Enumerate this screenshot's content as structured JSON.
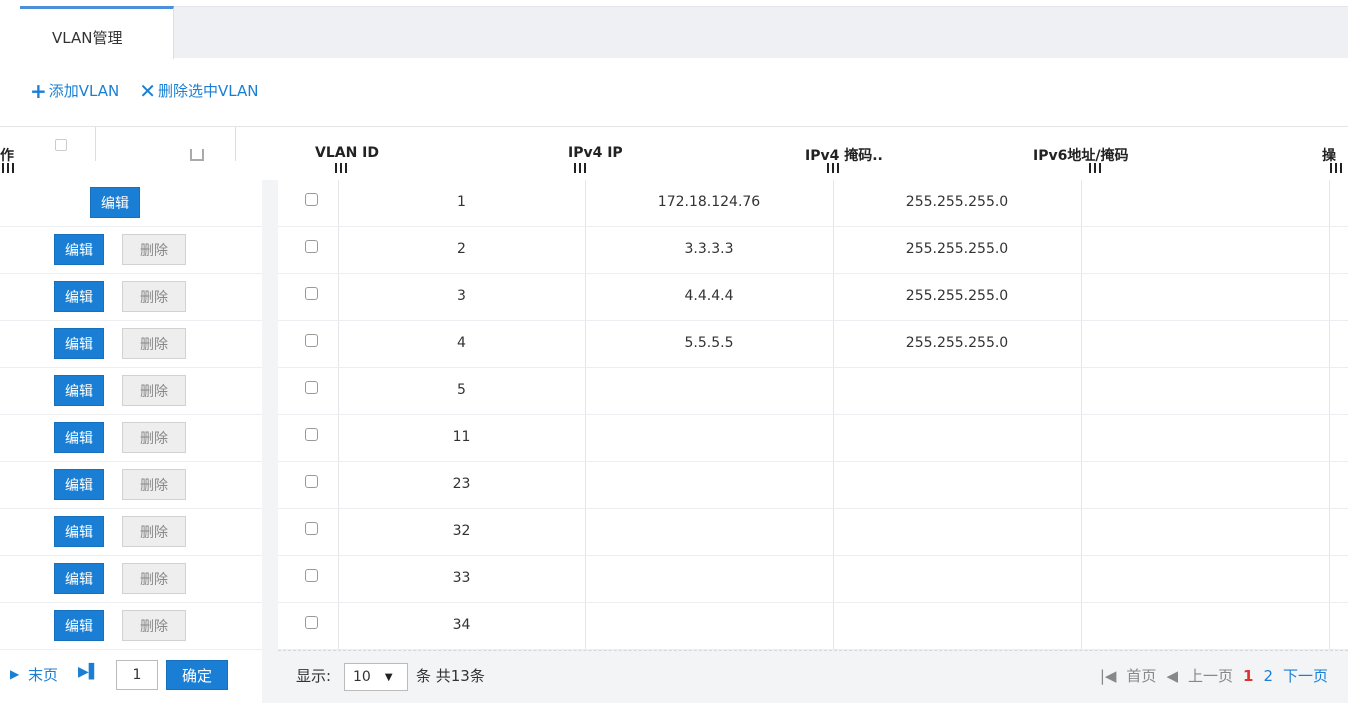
{
  "tabs": [
    {
      "label": "VLAN管理"
    }
  ],
  "toolbar": {
    "add_label": "添加VLAN",
    "delete_selected_label": "删除选中VLAN"
  },
  "table": {
    "columns": {
      "op_left": "作",
      "vlan_id": "VLAN ID",
      "ipv4_ip": "IPv4 IP",
      "ipv4_mask": "IPv4 掩码..",
      "ipv6": "IPv6地址/掩码",
      "op_right": "操"
    },
    "rows": [
      {
        "vlan_id": "1",
        "ipv4_ip": "172.18.124.76",
        "ipv4_mask": "255.255.255.0",
        "ipv6": ""
      },
      {
        "vlan_id": "2",
        "ipv4_ip": "3.3.3.3",
        "ipv4_mask": "255.255.255.0",
        "ipv6": ""
      },
      {
        "vlan_id": "3",
        "ipv4_ip": "4.4.4.4",
        "ipv4_mask": "255.255.255.0",
        "ipv6": ""
      },
      {
        "vlan_id": "4",
        "ipv4_ip": "5.5.5.5",
        "ipv4_mask": "255.255.255.0",
        "ipv6": ""
      },
      {
        "vlan_id": "5",
        "ipv4_ip": "",
        "ipv4_mask": "",
        "ipv6": ""
      },
      {
        "vlan_id": "11",
        "ipv4_ip": "",
        "ipv4_mask": "",
        "ipv6": ""
      },
      {
        "vlan_id": "23",
        "ipv4_ip": "",
        "ipv4_mask": "",
        "ipv6": ""
      },
      {
        "vlan_id": "32",
        "ipv4_ip": "",
        "ipv4_mask": "",
        "ipv6": ""
      },
      {
        "vlan_id": "33",
        "ipv4_ip": "",
        "ipv4_mask": "",
        "ipv6": ""
      },
      {
        "vlan_id": "34",
        "ipv4_ip": "",
        "ipv4_mask": "",
        "ipv6": ""
      }
    ],
    "edit_label": "编辑",
    "delete_label": "删除"
  },
  "pagination": {
    "last_label": "末页",
    "page_input": "1",
    "confirm_label": "确定",
    "show_label": "显示:",
    "page_size": "10",
    "total_label": "条 共13条",
    "first_label": "首页",
    "prev_label": "上一页",
    "pages": [
      "1",
      "2"
    ],
    "current_page": "1",
    "next_label": "下一页"
  },
  "colors": {
    "accent": "#1a7fd4",
    "current_page": "#e0332e"
  },
  "icons": [
    "plus-icon",
    "close-icon",
    "last-page-icon",
    "first-page-icon",
    "prev-icon",
    "dropdown-arrow-icon"
  ]
}
